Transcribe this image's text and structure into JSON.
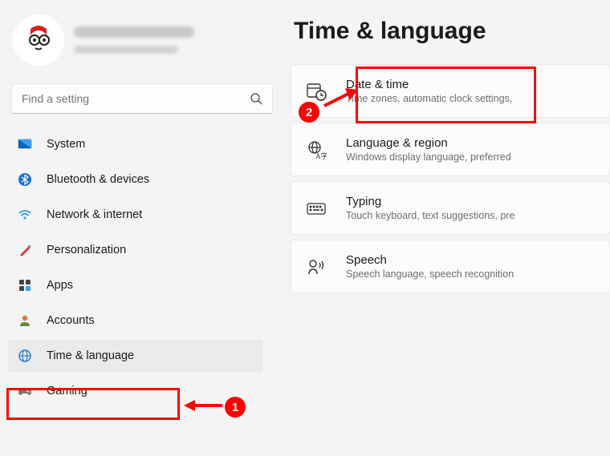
{
  "search": {
    "placeholder": "Find a setting"
  },
  "page": {
    "title": "Time & language"
  },
  "sidebar": {
    "items": [
      {
        "label": "System"
      },
      {
        "label": "Bluetooth & devices"
      },
      {
        "label": "Network & internet"
      },
      {
        "label": "Personalization"
      },
      {
        "label": "Apps"
      },
      {
        "label": "Accounts"
      },
      {
        "label": "Time & language"
      },
      {
        "label": "Gaming"
      }
    ]
  },
  "cards": [
    {
      "title": "Date & time",
      "sub": "Time zones, automatic clock settings,"
    },
    {
      "title": "Language & region",
      "sub": "Windows display language, preferred"
    },
    {
      "title": "Typing",
      "sub": "Touch keyboard, text suggestions, pre"
    },
    {
      "title": "Speech",
      "sub": "Speech language, speech recognition"
    }
  ],
  "annotations": {
    "badge1": "1",
    "badge2": "2"
  }
}
